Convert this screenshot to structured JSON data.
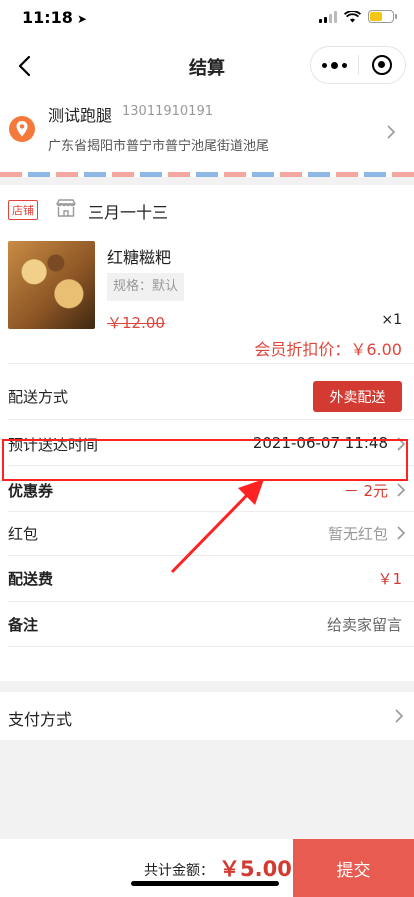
{
  "status": {
    "time": "11:18",
    "location_glyph": "➤"
  },
  "nav": {
    "title": "结算",
    "back_icon": "chevron-left-icon",
    "more_icon": "more-dots-icon",
    "close_icon": "target-icon"
  },
  "address": {
    "name": "测试跑腿",
    "phone": "13011910191",
    "detail": "广东省揭阳市普宁市普宁池尾街道池尾",
    "icon_color": "#f4793b"
  },
  "shop": {
    "tag": "店铺",
    "name": "三月一十三"
  },
  "product": {
    "name": "红糖糍粑",
    "spec": "规格：默认",
    "original_price": "￥12.00",
    "quantity": "×1",
    "member_price": "会员折扣价：￥6.00"
  },
  "rows": {
    "delivery_method_label": "配送方式",
    "delivery_method_button": "外卖配送",
    "eta_label": "预计送达时间",
    "eta_value": "2021-06-07 11:48",
    "coupon_label": "优惠券",
    "coupon_value": "－ 2元",
    "redpacket_label": "红包",
    "redpacket_value": "暂无红包",
    "fee_label": "配送费",
    "fee_value": "￥1",
    "note_label": "备注",
    "note_value": "给卖家留言"
  },
  "payment": {
    "label": "支付方式"
  },
  "footer": {
    "total_label": "共计金额：",
    "total_value": "￥5.00",
    "submit_label": "提交"
  },
  "colors": {
    "accent_red": "#d33a31",
    "submit_bg": "#e85b50",
    "highlight": "#ff2222"
  }
}
